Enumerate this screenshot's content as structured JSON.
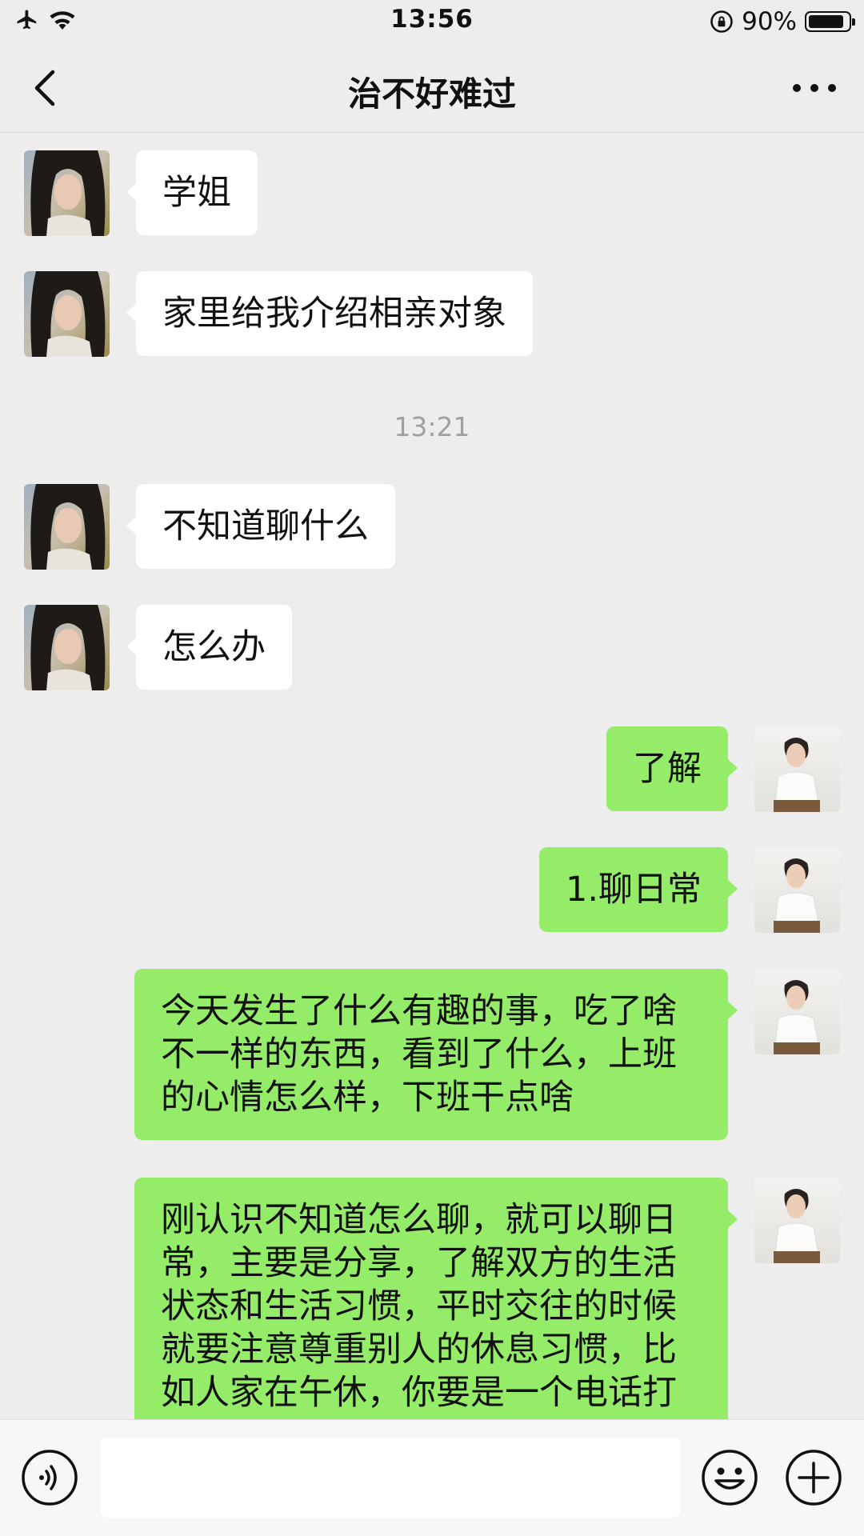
{
  "status_bar": {
    "time": "13:56",
    "battery_text": "90%",
    "battery_level": 0.9
  },
  "chat": {
    "title": "治不好难过"
  },
  "messages": [
    {
      "side": "in",
      "text": "学姐"
    },
    {
      "side": "in",
      "text": "家里给我介绍相亲对象"
    },
    {
      "side": "in",
      "text": "不知道聊什么"
    },
    {
      "side": "in",
      "text": "怎么办"
    },
    {
      "side": "out",
      "text": "了解"
    },
    {
      "side": "out",
      "text": "1.聊日常"
    },
    {
      "side": "out",
      "text": "今天发生了什么有趣的事，吃了啥不一样的东西，看到了什么，上班的心情怎么样，下班干点啥"
    },
    {
      "side": "out",
      "text": "刚认识不知道怎么聊，就可以聊日常，主要是分享，了解双方的生活状态和生活习惯，平时交往的时候就要注意尊重别人的休息习惯，比如人家在午休，你要是一个电话打"
    }
  ],
  "timestamp": "13:21",
  "input": {
    "value": ""
  },
  "colors": {
    "background": "#ededed",
    "incoming_bubble": "#ffffff",
    "outgoing_bubble": "#95ec69"
  },
  "icons": {
    "airplane": "airplane-icon",
    "wifi": "wifi-icon",
    "rotation_lock": "rotation-lock-icon",
    "battery": "battery-icon",
    "back": "back-chevron-icon",
    "more": "more-dots-icon",
    "voice": "voice-icon",
    "emoji": "emoji-icon",
    "add": "add-icon"
  }
}
